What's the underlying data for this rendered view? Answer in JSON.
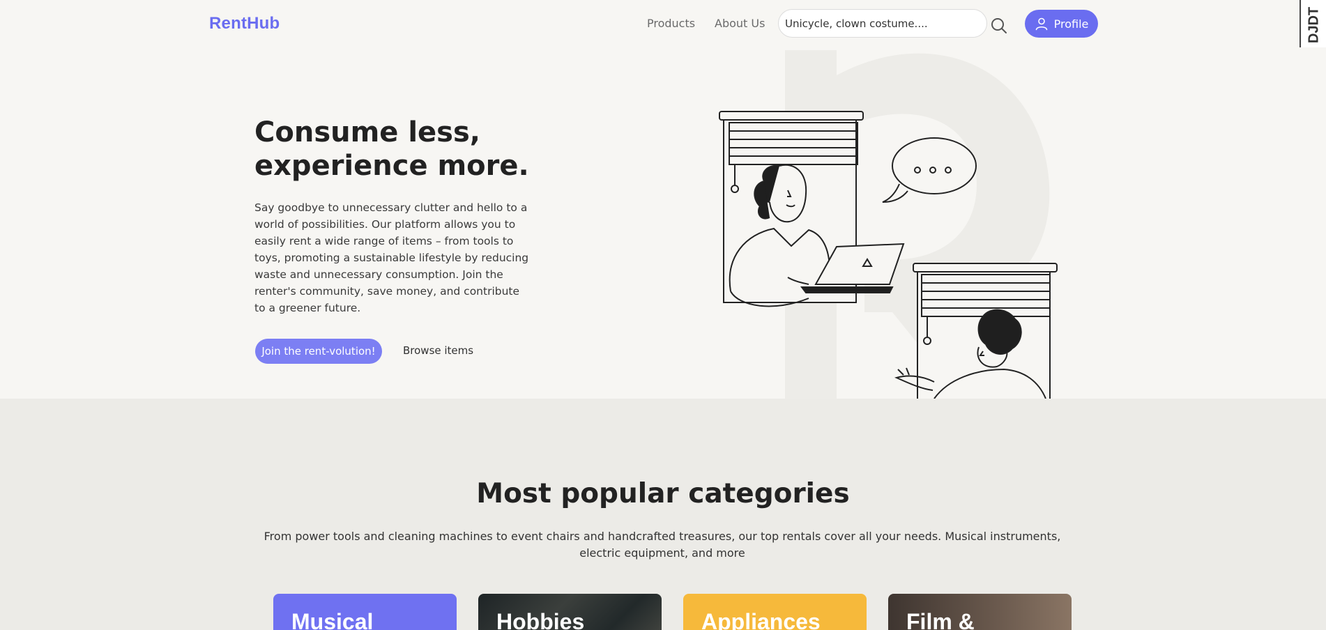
{
  "header": {
    "logo": "RentHub",
    "nav": [
      {
        "label": "Products"
      },
      {
        "label": "About Us"
      }
    ],
    "search": {
      "placeholder": "Unicycle, clown costume....",
      "value": ""
    },
    "profile_label": "Profile",
    "debug_toolbar_label": "DJDT"
  },
  "hero": {
    "title": "Consume less, experience more.",
    "description": "Say goodbye to unnecessary clutter and hello to a world of possibilities. Our platform allows you to easily rent a wide range of items – from tools to toys, promoting a sustainable lifestyle by reducing waste and unnecessary consumption. Join the renter's community, save money, and contribute to a greener future.",
    "primary_button": "Join the rent-volution!",
    "secondary_button": "Browse items"
  },
  "categories": {
    "title": "Most popular categories",
    "description": "From power tools and cleaning machines to event chairs and handcrafted treasures, our top rentals cover all your needs. Musical instruments, electric equipment, and more",
    "items": [
      {
        "label": "Musical",
        "color": "#6f71f1"
      },
      {
        "label": "Hobbies",
        "color": "#2a3030"
      },
      {
        "label": "Appliances",
        "color": "#f6b93b"
      },
      {
        "label": "Film &",
        "color": "#5a4a40"
      }
    ]
  },
  "colors": {
    "accent": "#6a6df0",
    "background": "#f7f6f3",
    "section_background": "#ecebe7"
  },
  "icons": [
    "search-icon",
    "user-icon"
  ]
}
